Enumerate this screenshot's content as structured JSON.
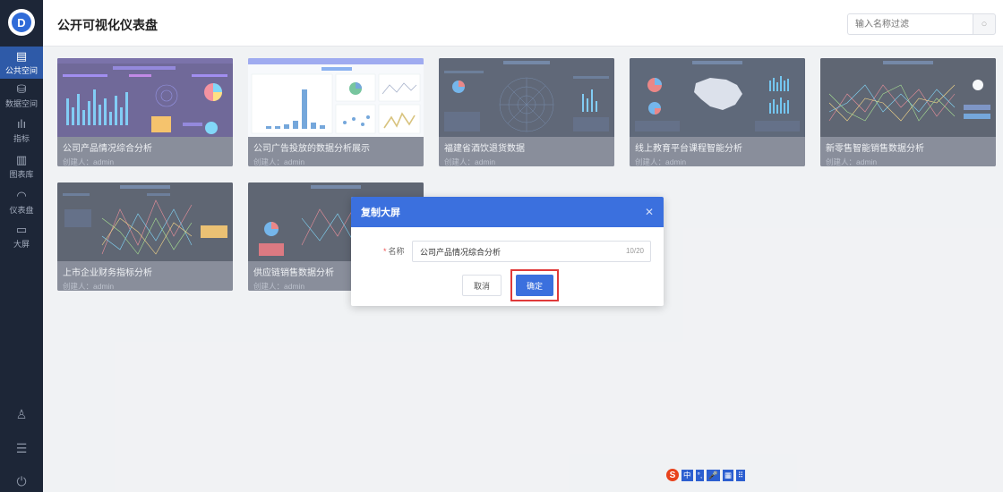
{
  "header": {
    "title": "公开可视化仪表盘",
    "search_placeholder": "输入名称过滤",
    "search_icon": "search-icon"
  },
  "sidebar": {
    "items": [
      {
        "label": "公共空间",
        "icon": "document-icon",
        "active": true
      },
      {
        "label": "数据空间",
        "icon": "database-icon",
        "active": false
      },
      {
        "label": "指标",
        "icon": "bar-chart-icon",
        "active": false
      },
      {
        "label": "图表库",
        "icon": "chart-library-icon",
        "active": false
      },
      {
        "label": "仪表盘",
        "icon": "gauge-icon",
        "active": false
      },
      {
        "label": "大屏",
        "icon": "monitor-icon",
        "active": false
      }
    ],
    "bottom": [
      "user-icon",
      "settings-sliders-icon",
      "power-icon"
    ]
  },
  "cards": [
    {
      "name": "公司产品情况综合分析",
      "creator": "创建人：admin"
    },
    {
      "name": "公司广告投放的数据分析展示",
      "creator": "创建人：admin"
    },
    {
      "name": "福建省酒饮退货数据",
      "creator": "创建人：admin"
    },
    {
      "name": "线上教育平台课程智能分析",
      "creator": "创建人：admin"
    },
    {
      "name": "新零售智能销售数据分析",
      "creator": "创建人：admin"
    },
    {
      "name": "上市企业财务指标分析",
      "creator": "创建人：admin"
    },
    {
      "name": "供应链销售数据分析",
      "creator": "创建人：admin"
    }
  ],
  "dialog": {
    "title": "复制大屏",
    "field_label": "名称",
    "field_value": "公司产品情况综合分析",
    "char_count": "10/20",
    "cancel_label": "取消",
    "ok_label": "确定"
  },
  "ime": {
    "logo": "S",
    "items": [
      "中",
      "°,",
      "🎤",
      "▦",
      "⠿"
    ]
  },
  "colors": {
    "accent": "#3b70de",
    "sidebar": "#1d2637",
    "highlight": "#e03a3a"
  }
}
